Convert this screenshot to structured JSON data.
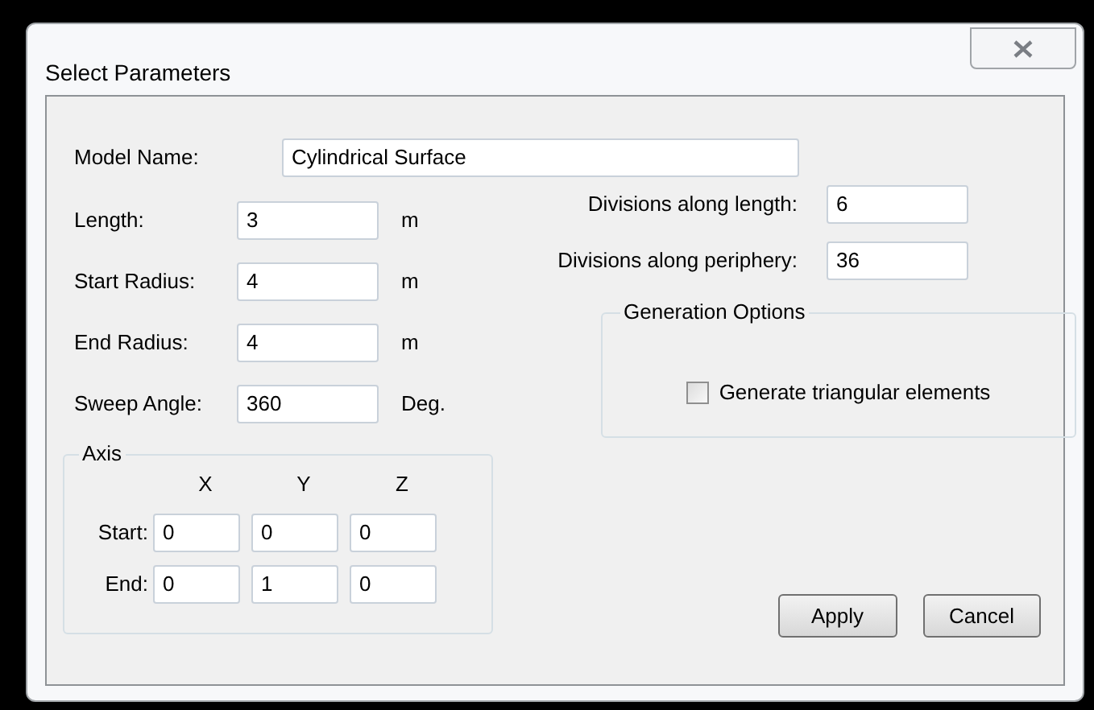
{
  "window": {
    "title": "Select Parameters"
  },
  "model_name": {
    "label": "Model Name:",
    "value": "Cylindrical Surface"
  },
  "left_fields": [
    {
      "label": "Length:",
      "value": "3",
      "unit": "m"
    },
    {
      "label": "Start Radius:",
      "value": "4",
      "unit": "m"
    },
    {
      "label": "End Radius:",
      "value": "4",
      "unit": "m"
    },
    {
      "label": "Sweep Angle:",
      "value": "360",
      "unit": "Deg."
    }
  ],
  "axis": {
    "title": "Axis",
    "columns": [
      "X",
      "Y",
      "Z"
    ],
    "rows": [
      {
        "label": "Start:",
        "values": [
          "0",
          "0",
          "0"
        ]
      },
      {
        "label": "End:",
        "values": [
          "0",
          "1",
          "0"
        ]
      }
    ]
  },
  "right_fields": [
    {
      "label": "Divisions along length:",
      "value": "6"
    },
    {
      "label": "Divisions along periphery:",
      "value": "36"
    }
  ],
  "generation_options": {
    "title": "Generation Options",
    "checkbox": {
      "label": "Generate triangular elements",
      "checked": false
    }
  },
  "buttons": [
    "Apply",
    "Cancel"
  ]
}
